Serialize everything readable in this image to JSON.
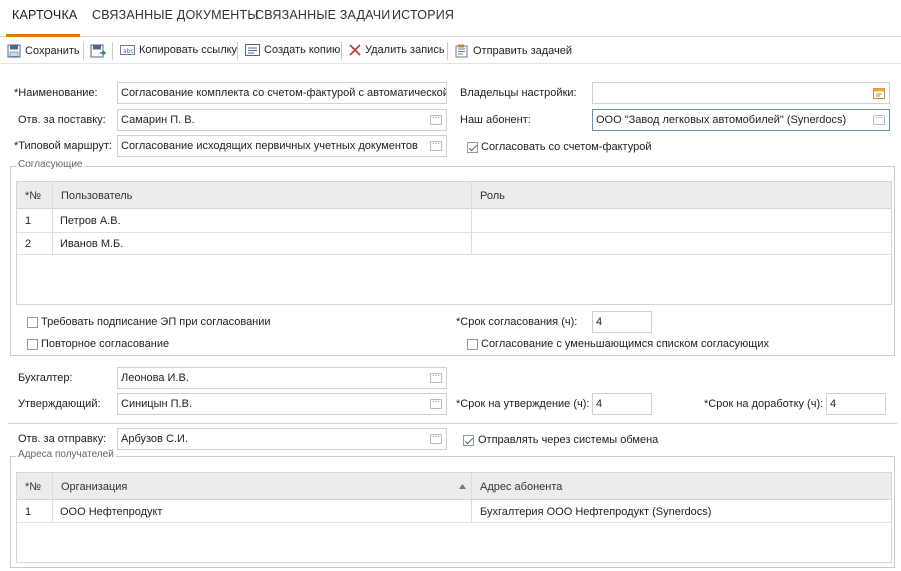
{
  "tabs": [
    "КАРТОЧКА",
    "СВЯЗАННЫЕ ДОКУМЕНТЫ",
    "СВЯЗАННЫЕ ЗАДАЧИ",
    "ИСТОРИЯ"
  ],
  "toolbar": {
    "save": "Сохранить",
    "copy_link": "Копировать ссылку",
    "create_copy": "Создать копию",
    "delete_record": "Удалить запись",
    "send_task": "Отправить задачей"
  },
  "form": {
    "name_label": "*Наименование:",
    "name_value": "Согласование комплекта со счетом-фактурой с автоматической",
    "owners_label": "Владельцы настройки:",
    "owners_value": "",
    "supply_label": "Отв. за поставку:",
    "supply_value": "Самарин П. В.",
    "subscriber_label": "Наш абонент:",
    "subscriber_value": "ООО \"Завод легковых автомобилей\" (Synerdocs)",
    "route_label": "*Типовой маршрут:",
    "route_value": "Согласование исходящих первичных учетных документов",
    "agree_invoice_label": "Согласовать со счетом-фактурой",
    "agree_invoice_checked": true
  },
  "approvers": {
    "title": "Согласующие",
    "columns": [
      "*№",
      "Пользователь",
      "Роль"
    ],
    "rows": [
      {
        "n": "1",
        "user": "Петров А.В.",
        "role": ""
      },
      {
        "n": "2",
        "user": "Иванов М.Б.",
        "role": ""
      }
    ],
    "require_sign_label": "Требовать подписание ЭП при согласовании",
    "require_sign_checked": false,
    "deadline_label": "*Срок согласования (ч):",
    "deadline_value": "4",
    "repeat_label": "Повторное согласование",
    "repeat_checked": false,
    "decreasing_label": "Согласование с уменьшающимся списком согласующих",
    "decreasing_checked": false
  },
  "accountant": {
    "label": "Бухгалтер:",
    "value": "Леонова И.В."
  },
  "approver": {
    "label": "Утверждающий:",
    "value": "Синицын П.В.",
    "approve_deadline_label": "*Срок на утверждение (ч):",
    "approve_deadline_value": "4",
    "rework_deadline_label": "*Срок на доработку (ч):",
    "rework_deadline_value": "4"
  },
  "sender": {
    "label": "Отв. за отправку:",
    "value": "Арбузов С.И.",
    "exchange_label": "Отправлять через системы обмена",
    "exchange_checked": true
  },
  "recipients": {
    "title": "Адреса получателей",
    "columns": [
      "*№",
      "Организация",
      "Адрес абонента"
    ],
    "rows": [
      {
        "n": "1",
        "org": "ООО Нефтепродукт",
        "address": "Бухгалтерия ООО Нефтепродукт (Synerdocs)"
      }
    ]
  },
  "colors": {
    "accent": "#e07b00",
    "focus_border": "#6f8fb0",
    "check": "#3b6ea5"
  }
}
